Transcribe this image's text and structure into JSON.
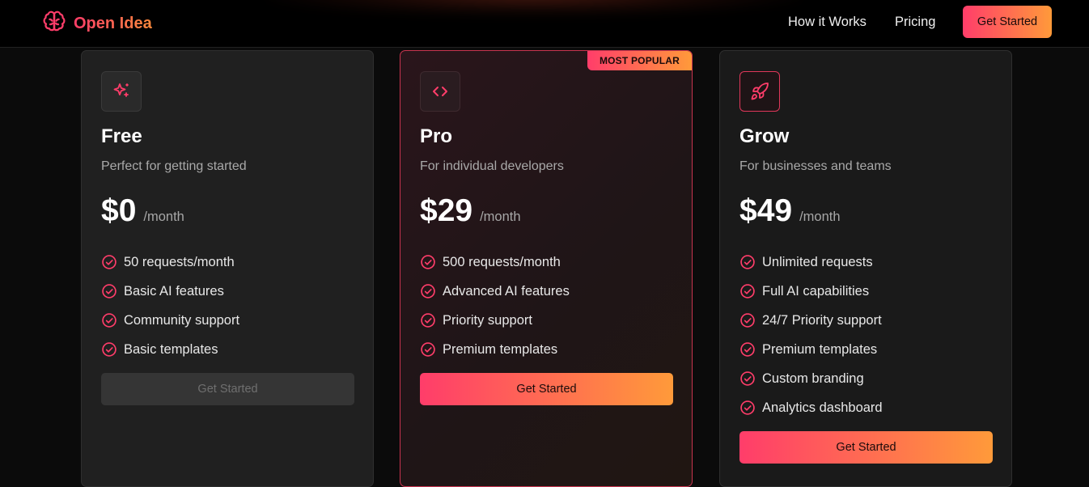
{
  "nav": {
    "brand": "Open Idea",
    "brand_icon": "brain-icon",
    "links": [
      {
        "label": "How it Works"
      },
      {
        "label": "Pricing"
      }
    ],
    "cta_label": "Get Started"
  },
  "colors": {
    "accent_start": "#ff3d6a",
    "accent_end": "#ff9a3a",
    "check": "#ff3d6a"
  },
  "plans": [
    {
      "name": "Free",
      "icon": "sparkles-icon",
      "description": "Perfect for getting started",
      "price": "$0",
      "period": "/month",
      "features": [
        "50 requests/month",
        "Basic AI features",
        "Community support",
        "Basic templates"
      ],
      "button_label": "Get Started"
    },
    {
      "name": "Pro",
      "icon": "code-icon",
      "badge": "MOST POPULAR",
      "description": "For individual developers",
      "price": "$29",
      "period": "/month",
      "features": [
        "500 requests/month",
        "Advanced AI features",
        "Priority support",
        "Premium templates"
      ],
      "button_label": "Get Started"
    },
    {
      "name": "Grow",
      "icon": "rocket-icon",
      "description": "For businesses and teams",
      "price": "$49",
      "period": "/month",
      "features": [
        "Unlimited requests",
        "Full AI capabilities",
        "24/7 Priority support",
        "Premium templates",
        "Custom branding",
        "Analytics dashboard"
      ],
      "button_label": "Get Started"
    }
  ]
}
